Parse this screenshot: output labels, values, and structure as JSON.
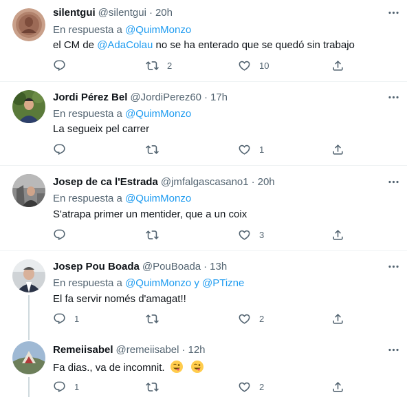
{
  "tweets": [
    {
      "name": "silentgui",
      "handle": "@silentgui",
      "dot": "·",
      "time": "20h",
      "reply_prefix": "En respuesta a",
      "reply_mentions": [
        "@QuimMonzo"
      ],
      "text_parts": [
        "el CM de ",
        "@AdaColau",
        " no se ha enterado que se quedó sin trabajo"
      ],
      "replies": "",
      "retweets": "2",
      "likes": "10"
    },
    {
      "name": "Jordi Pérez Bel",
      "handle": "@JordiPerez60",
      "dot": "·",
      "time": "17h",
      "reply_prefix": "En respuesta a",
      "reply_mentions": [
        "@QuimMonzo"
      ],
      "text": "La segueix pel carrer",
      "replies": "",
      "retweets": "",
      "likes": "1"
    },
    {
      "name": "Josep de ca l'Estrada",
      "handle": "@jmfalgascasano1",
      "dot": "·",
      "time": "20h",
      "reply_prefix": "En respuesta a",
      "reply_mentions": [
        "@QuimMonzo"
      ],
      "text": "S'atrapa primer un mentider, que a un coix",
      "replies": "",
      "retweets": "",
      "likes": "3"
    },
    {
      "name": "Josep Pou Boada",
      "handle": "@PouBoada",
      "dot": "·",
      "time": "13h",
      "reply_prefix": "En respuesta a",
      "reply_mentions": [
        "@QuimMonzo",
        "y",
        "@PTizne"
      ],
      "text": "El fa servir només d'amagat!!",
      "replies": "1",
      "retweets": "",
      "likes": "2"
    },
    {
      "name": "Remeiisabel",
      "handle": "@remeiisabel",
      "dot": "·",
      "time": "12h",
      "text": "Fa dias., va de incomnit.",
      "emojis": [
        "winking-face-with-tongue",
        "winking-face-with-tongue"
      ],
      "replies": "1",
      "retweets": "",
      "likes": "2"
    }
  ],
  "icons": {
    "more": "more-icon",
    "reply": "reply-icon",
    "retweet": "retweet-icon",
    "like": "heart-icon",
    "share": "share-icon"
  },
  "colors": {
    "accent": "#1d9bf0",
    "secondary_text": "#536471",
    "divider": "#eff3f4"
  }
}
